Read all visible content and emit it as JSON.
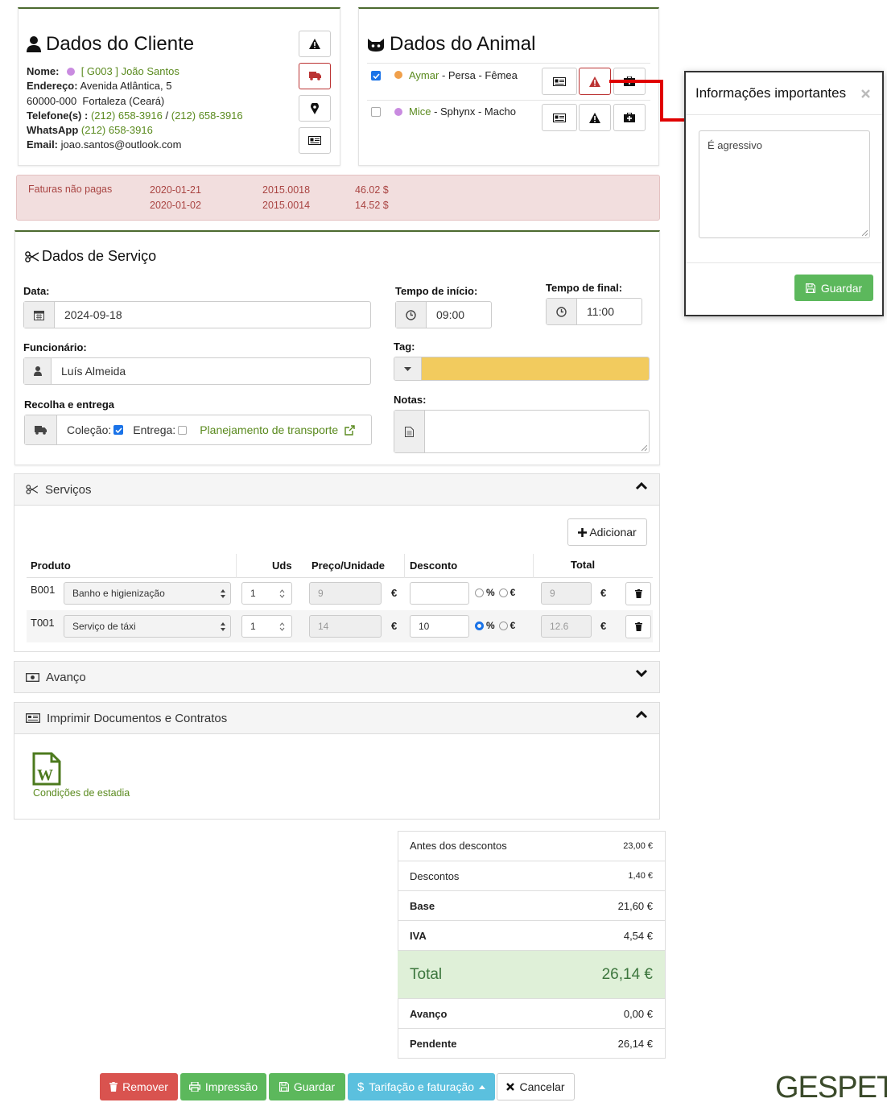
{
  "client": {
    "title": "Dados do Cliente",
    "name_label": "Nome:",
    "name_value": "[ G003 ] João Santos",
    "address_label": "Endereço:",
    "address_value": "Avenida Atlântica, 5",
    "city": "60000-000  Fortaleza (Ceará)",
    "phone_label": "Telefone(s) :",
    "phone1": "(212) 658-3916",
    "phone_sep": "/",
    "phone2": "(212) 658-3916",
    "whatsapp_label": "WhatsApp",
    "whatsapp_value": "(212) 658-3916",
    "email_label": "Email:",
    "email_value": "joao.santos@outlook.com"
  },
  "animal": {
    "title": "Dados do Animal",
    "rows": [
      {
        "name": "Aymar",
        "details": " - Persa - Fêmea",
        "checked": true,
        "dot": "#f0a04b"
      },
      {
        "name": "Mice",
        "details": " - Sphynx - Macho",
        "checked": false,
        "dot": "#c98be0"
      }
    ]
  },
  "invoices": {
    "label": "Faturas não pagas",
    "rows": [
      {
        "date": "2020-01-21",
        "number": "2015.0018",
        "amount": "46.02 $"
      },
      {
        "date": "2020-01-02",
        "number": "2015.0014",
        "amount": "14.52 $"
      }
    ]
  },
  "service": {
    "title": "Dados de Serviço",
    "date_label": "Data:",
    "date_value": "2024-09-18",
    "start_label": "Tempo de início:",
    "start_value": "09:00",
    "end_label": "Tempo de final:",
    "end_value": "11:00",
    "employee_label": "Funcionário:",
    "employee_value": "Luís Almeida",
    "tag_label": "Tag:",
    "tag_color": "#f2cb5e",
    "pickup_label": "Recolha e entrega",
    "collection_label": "Coleção:",
    "delivery_label": "Entrega:",
    "transport_link": "Planejamento de transporte",
    "notes_label": "Notas:"
  },
  "services_section": {
    "title": "Serviços",
    "add_button": "Adicionar",
    "headers": {
      "product": "Produto",
      "units": "Uds",
      "price": "Preço/Unidade",
      "discount": "Desconto",
      "total": "Total"
    },
    "currency": "€",
    "percent": "%",
    "rows": [
      {
        "code": "B001",
        "product": "Banho e higienização",
        "units": "1",
        "price": "9",
        "discount": "",
        "percent_selected": false,
        "total": "9"
      },
      {
        "code": "T001",
        "product": "Serviço de táxi",
        "units": "1",
        "price": "14",
        "discount": "10",
        "percent_selected": true,
        "total": "12.6"
      }
    ]
  },
  "advance_section": {
    "title": "Avanço"
  },
  "print_section": {
    "title": "Imprimir Documentos e Contratos",
    "doc_label": "Condições de estadia"
  },
  "summary": {
    "before_label": "Antes dos descontos",
    "before_value": "23,00 €",
    "discounts_label": "Descontos",
    "discounts_value": "1,40 €",
    "base_label": "Base",
    "base_value": "21,60 €",
    "vat_label": "IVA",
    "vat_value": "4,54 €",
    "total_label": "Total",
    "total_value": "26,14 €",
    "advance_label": "Avanço",
    "advance_value": "0,00 €",
    "pending_label": "Pendente",
    "pending_value": "26,14 €"
  },
  "buttons": {
    "remove": "Remover",
    "print": "Impressão",
    "save": "Guardar",
    "billing": "Tarifação e faturação",
    "cancel": "Cancelar"
  },
  "popup": {
    "title": "Informações importantes",
    "text": "É agressivo",
    "save": "Guardar"
  },
  "brand": "GESPET"
}
